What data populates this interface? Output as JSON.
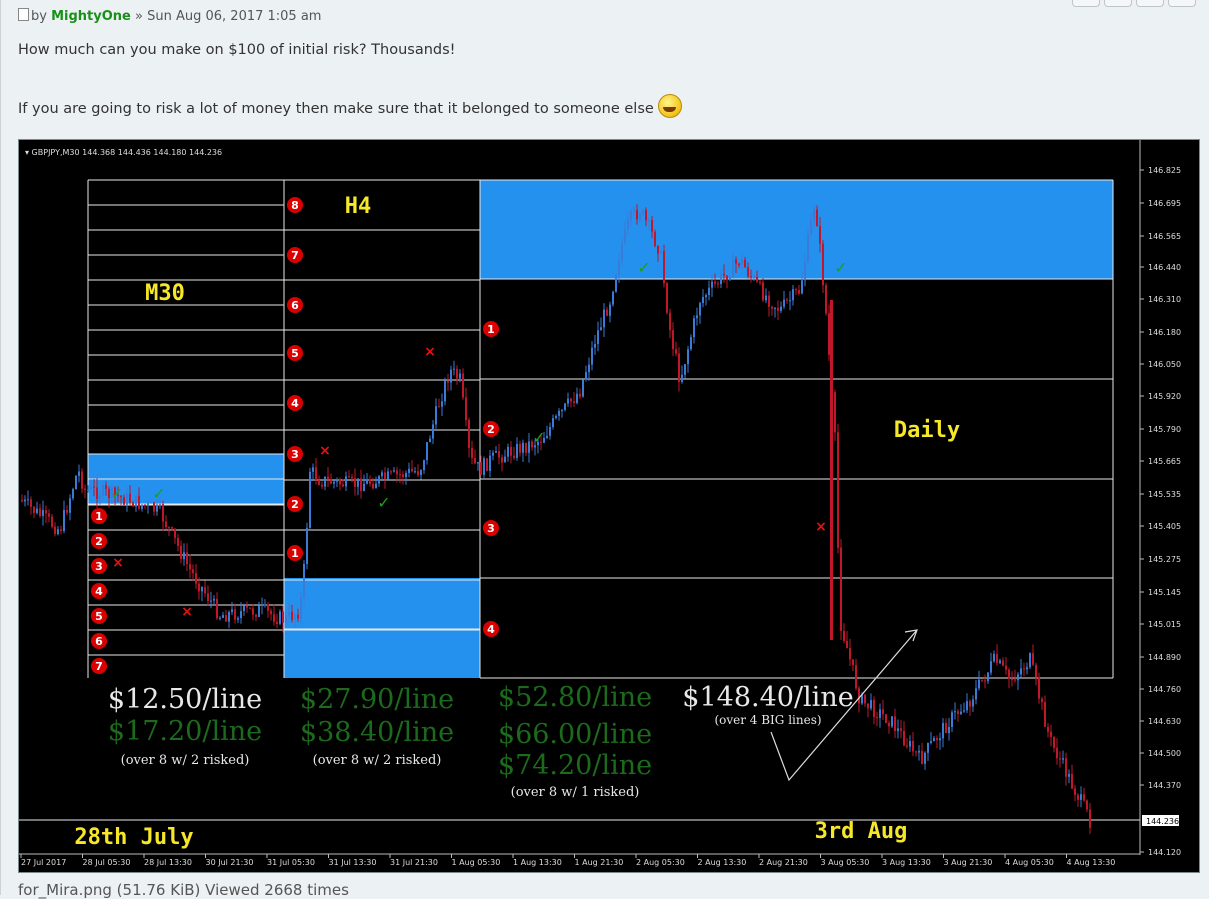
{
  "post": {
    "meta_by": "by",
    "author": "MightyOne",
    "separator": "»",
    "date": "Sun Aug 06, 2017 1:05 am",
    "line1": "How much can you make on $100 of initial risk? Thousands!",
    "line2": "If you are going to risk a lot of money then make sure that it belonged to someone else",
    "caption": "for_Mira.png (51.76 KiB) Viewed 2668 times"
  },
  "chart": {
    "header": "GBPJPY,M30  144.368 144.436 144.180 144.236",
    "price_labels": [
      "146.825",
      "146.695",
      "146.565",
      "146.440",
      "146.310",
      "146.180",
      "146.050",
      "145.920",
      "145.790",
      "145.665",
      "145.535",
      "145.405",
      "145.275",
      "145.145",
      "145.015",
      "144.890",
      "144.760",
      "144.630",
      "144.500",
      "144.370",
      "144.120"
    ],
    "current_price": "144.236",
    "time_labels": [
      "27 Jul 2017",
      "28 Jul 05:30",
      "28 Jul 13:30",
      "30 Jul 21:30",
      "31 Jul 05:30",
      "31 Jul 13:30",
      "31 Jul 21:30",
      "1 Aug 05:30",
      "1 Aug 13:30",
      "1 Aug 21:30",
      "2 Aug 05:30",
      "2 Aug 13:30",
      "2 Aug 21:30",
      "3 Aug 05:30",
      "3 Aug 13:30",
      "3 Aug 21:30",
      "4 Aug 05:30",
      "4 Aug 13:30"
    ],
    "labels": {
      "m30": "M30",
      "h4": "H4",
      "daily": "Daily",
      "date_left": "28th July",
      "date_right": "3rd Aug"
    },
    "m30_numbers": [
      "1",
      "2",
      "3",
      "4",
      "5",
      "6",
      "7"
    ],
    "h4_numbers_left": [
      "8",
      "7",
      "6",
      "5",
      "4",
      "3",
      "2",
      "1"
    ],
    "daily_numbers": [
      "1",
      "2",
      "3",
      "4"
    ],
    "profits": {
      "col1_line1": "$12.50/line",
      "col1_line2": "$17.20/line",
      "col1_note": "(over 8 w/ 2 risked)",
      "col2_line1": "$27.90/line",
      "col2_line2": "$38.40/line",
      "col2_note": "(over 8 w/ 2 risked)",
      "col3_line1": "$52.80/line",
      "col3_line2": "$66.00/line",
      "col3_line3": "$74.20/line",
      "col3_note": "(over 8 w/ 1 risked)",
      "col4_line1": "$148.40/line",
      "col4_note": "(over 4 BIG lines)"
    },
    "colors": {
      "background": "#000000",
      "zone_blue": "#2591ee",
      "bull": "#3a7bd5",
      "bear": "#c0182a",
      "profit_white": "#e8e8e8",
      "profit_green": "#1c6b1c",
      "label_yellow": "#f6e829",
      "marker_red": "#e81010"
    }
  }
}
